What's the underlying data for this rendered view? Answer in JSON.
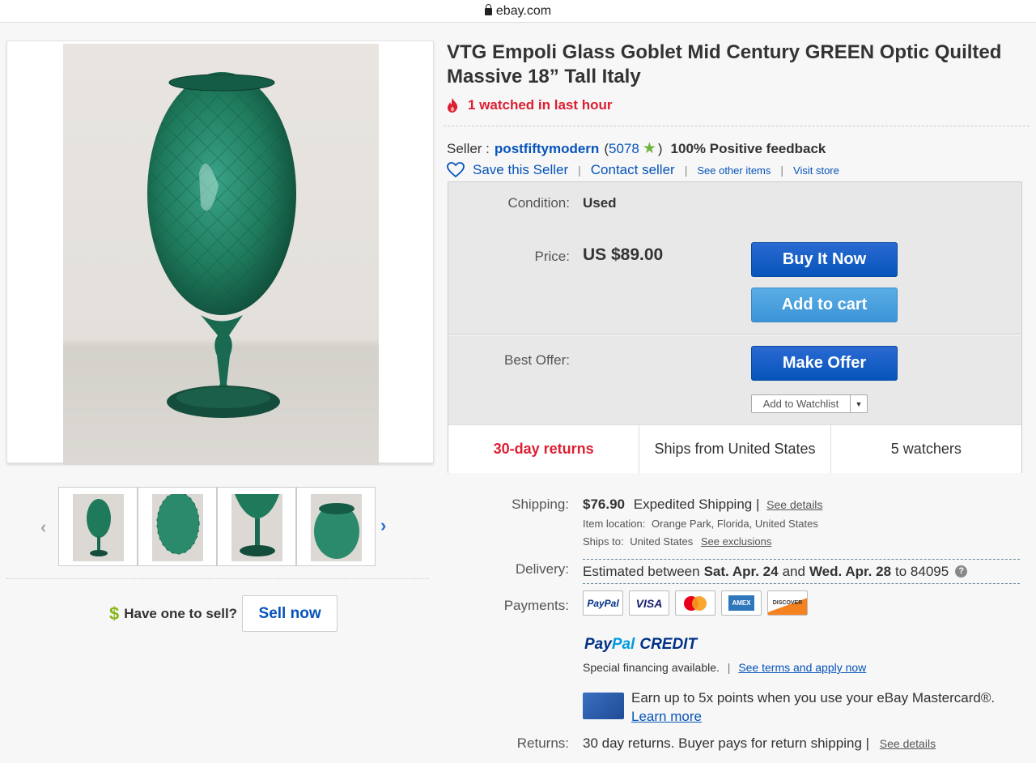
{
  "browser": {
    "url": "ebay.com"
  },
  "listing": {
    "title": "VTG Empoli Glass Goblet Mid Century GREEN Optic Quilted Massive 18” Tall Italy",
    "watched": "1 watched in last hour"
  },
  "seller": {
    "prefix": "Seller :",
    "name": "postfiftymodern",
    "score": "5078",
    "open_paren": "(",
    "close_paren": ")",
    "feedback": "100% Positive feedback",
    "save": "Save this Seller",
    "contact": "Contact seller",
    "other_items": "See other items",
    "visit_store": "Visit store"
  },
  "buybox": {
    "condition_label": "Condition:",
    "condition_value": "Used",
    "price_label": "Price:",
    "price_value": "US $89.00",
    "buy_now": "Buy It Now",
    "add_to_cart": "Add to cart",
    "best_offer_label": "Best Offer:",
    "make_offer": "Make Offer",
    "watchlist": "Add to Watchlist",
    "returns": "30-day returns",
    "ships_from": "Ships from United States",
    "watchers": "5 watchers"
  },
  "shipping": {
    "label": "Shipping:",
    "cost": "$76.90",
    "method": "Expedited Shipping",
    "pipe": "|",
    "details_link": "See details",
    "location_label": "Item location:",
    "location": "Orange Park, Florida, United States",
    "ships_to_label": "Ships to:",
    "ships_to": "United States",
    "exclusions_link": "See exclusions"
  },
  "delivery": {
    "label": "Delivery:",
    "prefix": "Estimated between",
    "start": "Sat. Apr. 24",
    "and": "and",
    "end": "Wed. Apr. 28",
    "to": "to 84095",
    "help": "?"
  },
  "payments": {
    "label": "Payments:",
    "methods": [
      "PayPal",
      "VISA",
      "Mastercard",
      "American Express",
      "Discover"
    ],
    "paypal_text": "PayPal",
    "visa_text": "VISA",
    "amex_text": "AMEX",
    "discover_text": "DISCOVER",
    "paypal_credit_a": "Pay",
    "paypal_credit_b": "Pal",
    "paypal_credit_c": "CREDIT",
    "financing": "Special financing available.",
    "financing_pipe": "|",
    "financing_link": "See terms and apply now",
    "mastercard_text": "Earn up to 5x points when you use your eBay Mastercard®.",
    "learn_more": "Learn more"
  },
  "returns_row": {
    "label": "Returns:",
    "text": "30 day returns. Buyer pays for return shipping",
    "pipe": "|",
    "details_link": "See details"
  },
  "sell": {
    "dollar": "$",
    "question": "Have one to sell?",
    "button": "Sell now"
  },
  "thumbs": {
    "prev": "‹",
    "next": "›"
  },
  "colors": {
    "link_blue": "#0654ba",
    "alert_red": "#dd1e31",
    "glass_green": "#1f7a5c",
    "star_green": "#6db33f"
  }
}
